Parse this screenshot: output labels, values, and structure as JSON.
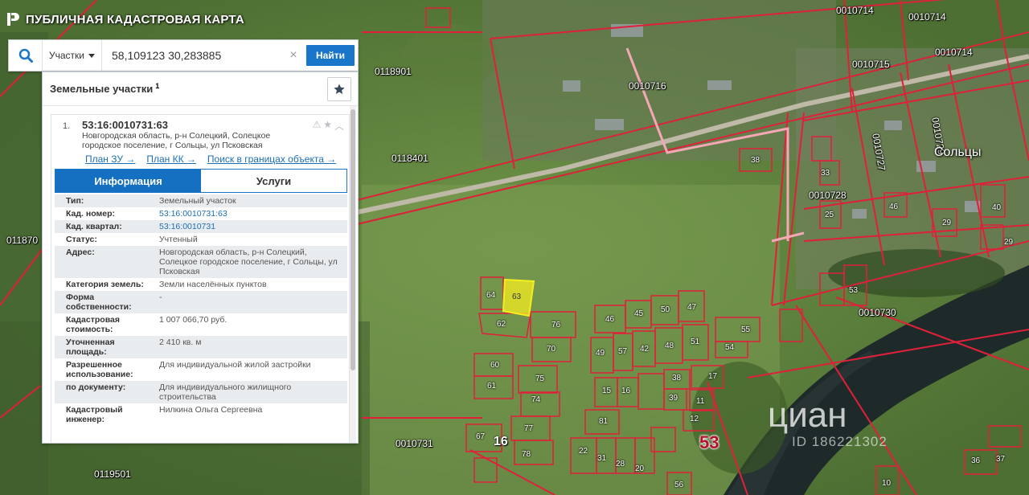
{
  "app": {
    "title": "ПУБЛИЧНАЯ КАДАСТРОВАЯ КАРТА",
    "logo_icon": "pkk-logo-icon"
  },
  "search": {
    "type_label": "Участки",
    "query": "58,109123 30,283885",
    "clear_label": "×",
    "find_label": "Найти"
  },
  "panel": {
    "title": "Земельные участки",
    "count_sup": "1",
    "result": {
      "index": "1.",
      "cad_number": "53:16:0010731:63",
      "address": "Новгородская область, р-н Солецкий, Солецкое городское поселение, г Сольцы, ул Псковская",
      "links": [
        "План ЗУ →",
        "План КК →",
        "Поиск в границах объекта →"
      ],
      "tabs": [
        "Информация",
        "Услуги"
      ],
      "active_tab": "Информация"
    },
    "attributes": [
      {
        "key": "Тип:",
        "value": "Земельный участок",
        "link": false
      },
      {
        "key": "Кад. номер:",
        "value": "53:16:0010731:63",
        "link": true
      },
      {
        "key": "Кад. квартал:",
        "value": "53:16:0010731",
        "link": true
      },
      {
        "key": "Статус:",
        "value": "Учтенный",
        "link": false
      },
      {
        "key": "Адрес:",
        "value": "Новгородская область, р-н Солецкий, Солецкое городское поселение, г Сольцы, ул Псковская",
        "link": false
      },
      {
        "key": "Категория земель:",
        "value": "Земли населённых пунктов",
        "link": false
      },
      {
        "key": "Форма собственности:",
        "value": "-",
        "link": false
      },
      {
        "key": "Кадастровая стоимость:",
        "value": "1 007 066,70 руб.",
        "link": false
      },
      {
        "key": "Уточненная площадь:",
        "value": "2 410 кв. м",
        "link": false
      },
      {
        "key": "Разрешенное использование:",
        "value": "Для индивидуальной жилой застройки",
        "link": false
      },
      {
        "key": "по документу:",
        "value": "Для индивидуального жилищного строительства",
        "link": false
      },
      {
        "key": "Кадастровый инженер:",
        "value": "Нилкина Ольга Сергеевна",
        "link": false
      }
    ]
  },
  "map": {
    "town": "Сольцы",
    "quarter_big": "53",
    "quarter_16": "16",
    "labels": [
      "0010714",
      "0010715",
      "0010715",
      "0010714",
      "0118901",
      "0010716",
      "0118401",
      "0010728",
      "0010730",
      "0010731",
      "0119501",
      "011870",
      "0010729",
      "0010727"
    ],
    "plots": [
      "38",
      "64",
      "63",
      "62",
      "76",
      "70",
      "46",
      "45",
      "50",
      "47",
      "60",
      "61",
      "75",
      "74",
      "77",
      "78",
      "67",
      "81",
      "49",
      "57",
      "42",
      "48",
      "51",
      "55",
      "54",
      "53",
      "15",
      "16",
      "39",
      "38",
      "17",
      "11",
      "12",
      "29",
      "31",
      "28",
      "20",
      "56",
      "22",
      "33",
      "25",
      "10",
      "40",
      "29",
      "46",
      "37",
      "36"
    ]
  },
  "watermark": {
    "brand": "циан",
    "id": "ID 186221302"
  },
  "colors": {
    "accent": "#1570c1",
    "boundary": "#e0203a",
    "selected_plot": "#f5ee20"
  }
}
